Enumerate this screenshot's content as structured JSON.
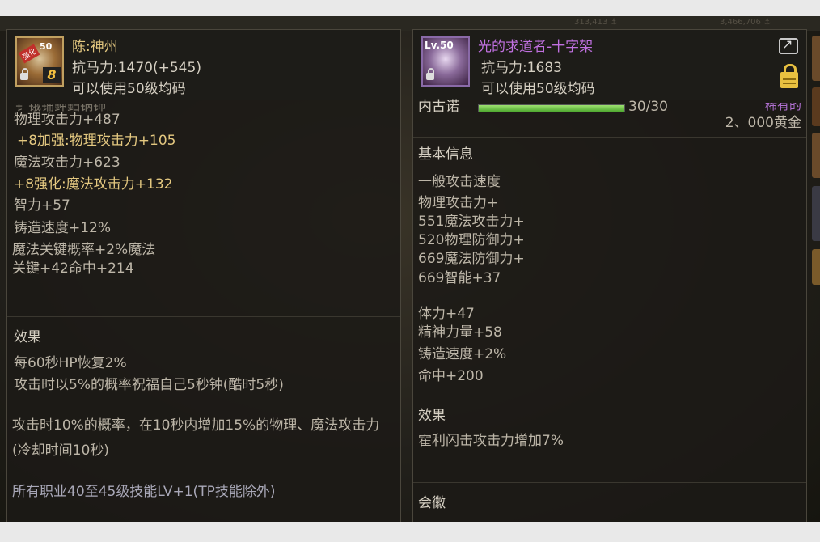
{
  "top_bar": {
    "left": "313,413 ⚓",
    "right": "3,466,706 ⚓"
  },
  "left_item": {
    "icon_tag": "强化",
    "icon_level": "50",
    "icon_plus": "8",
    "name": "陈:神州",
    "anti_magic": "抗马力:1470(+545)",
    "usage": "可以使用50级均码",
    "cut_line": "钅锇铺鉀鈤锅铈",
    "stats": [
      "物理攻击力+487",
      " +8加强:物理攻击力+105",
      "魔法攻击力+623",
      " +8强化:魔法攻击力+132",
      "智力+57",
      "铸造速度+12%",
      "魔法关键概率+2%魔法",
      "关键+42命中+214"
    ],
    "effect_header": "效果",
    "effects": [
      "每60秒HP恢复2%",
      "攻击时以5%的概率祝福自己5秒钟(酷时5秒)"
    ],
    "effect2_lines": [
      "攻击时10%的概率，在10秒内增加15%的物理、魔法攻击力",
      "(冷却时间10秒)"
    ],
    "skill_bonus": "所有职业40至45级技能LV+1(TP技能除外)"
  },
  "right_item": {
    "icon_level": "Lv.50",
    "name": "光的求道者-十字架",
    "name_color": "#c070e0",
    "anti_magic": "抗马力:1683",
    "usage": "可以使用50级均码",
    "durability_label": "内古诺",
    "durability": "30/30",
    "durability_fraction": 1.0,
    "rarity_cut": "稀有的",
    "price": "2、000黄金",
    "basic_header": "基本信息",
    "basic": [
      "一般攻击速度",
      "物理攻击力+",
      "551魔法攻击力+",
      "520物理防御力+",
      "669魔法防御力+",
      "669智能+37"
    ],
    "stats": [
      "体力+47",
      "精神力量+58",
      "铸造速度+2%",
      "命中+200"
    ],
    "effect_header": "效果",
    "effect": "霍利闪击攻击力增加7%",
    "emblem_header": "会徽"
  }
}
